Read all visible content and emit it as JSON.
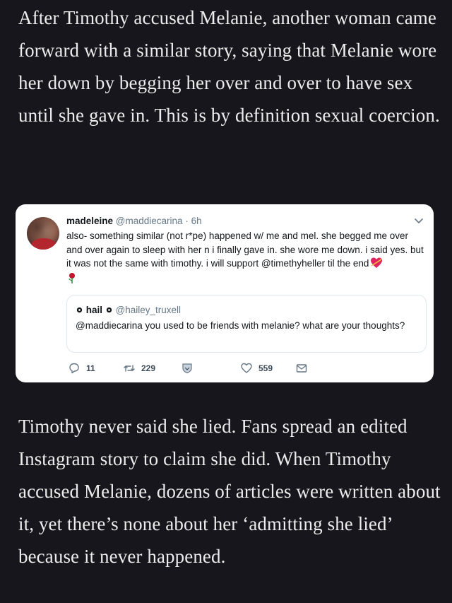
{
  "article": {
    "paragraph1": "After Timothy accused Melanie, another woman came forward with a similar story, saying that Melanie wore her down by begging her over and over to have sex until she gave in. This is by definition sexual coercion.",
    "paragraph2": "Timothy never said she lied. Fans spread an edited Instagram story to claim she did. When Timothy accused Melanie, dozens of articles were written about it, yet there’s none about her ‘admitting she lied’ because it never happened."
  },
  "tweet": {
    "name": "madeleine",
    "handle": "@maddiecarina",
    "time": "· 6h",
    "text": "also- something similar (not r*pe) happened w/ me and mel. she begged me over and over again to sleep with her n i finally gave in. she wore me down. i said yes. but it was not the same with timothy. i will support @timethyheller til the end",
    "quote": {
      "name": "hail",
      "handle": "@hailey_truxell",
      "text": "@maddiecarina you used to be friends with melanie? what are your thoughts?"
    },
    "actions": {
      "replies": "11",
      "retweets": "229",
      "likes": "559"
    },
    "icons": [
      "chevron-down-icon",
      "reply-icon",
      "retweet-icon",
      "shield-icon",
      "heart-icon",
      "mail-icon",
      "rose-emoji",
      "heart-emoji",
      "gear-icon"
    ],
    "colors": {
      "text_dark": "#14171a",
      "text_muted": "#657786",
      "border": "#e1e8ed",
      "background": "#16161c"
    }
  }
}
